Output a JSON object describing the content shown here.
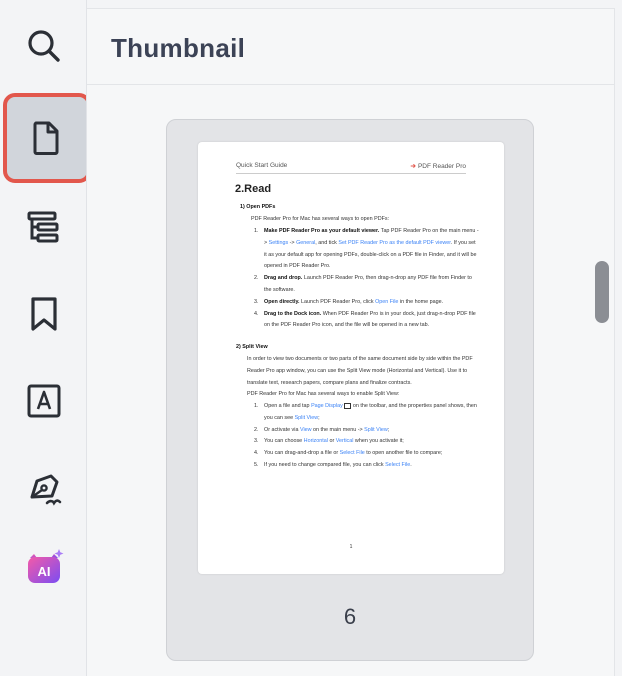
{
  "sidebar": {
    "items": [
      {
        "name": "search",
        "icon": "search-icon"
      },
      {
        "name": "thumbnail",
        "icon": "page-icon",
        "active": true
      },
      {
        "name": "outline",
        "icon": "outline-tree-icon"
      },
      {
        "name": "bookmarks",
        "icon": "bookmark-icon"
      },
      {
        "name": "annotation",
        "icon": "text-box-icon"
      },
      {
        "name": "signature",
        "icon": "pen-nib-icon"
      },
      {
        "name": "ai",
        "icon": "ai-assistant-icon",
        "label": "AI"
      }
    ]
  },
  "panel": {
    "title": "Thumbnail"
  },
  "thumbnail": {
    "page_label": "6",
    "page": {
      "header_left": "Quick Start Guide",
      "header_right": "PDF Reader Pro",
      "heading": "2.Read",
      "s1_title": "1)   Open PDFs",
      "s1_intro": "PDF Reader Pro for Mac has several ways to open PDFs:",
      "s1_i1_bold": "Make PDF Reader Pro as your default viewer.",
      "s1_i1_a": " Tap PDF Reader Pro on the main menu -> ",
      "s1_i1_link1": "Settings",
      "s1_i1_b": " -> ",
      "s1_i1_link2": "General",
      "s1_i1_c": ", and tick ",
      "s1_i1_link3": "Set PDF Reader Pro as the default PDF viewer",
      "s1_i1_d": ". If you set it as your default app for opening PDFs, double-click on a PDF file in Finder, and it will be opened in PDF Reader Pro.",
      "s1_i2_bold": "Drag and drop.",
      "s1_i2": " Launch PDF Reader Pro, then drag-n-drop any PDF file from Finder to the software.",
      "s1_i3_bold": "Open directly.",
      "s1_i3_a": " Launch PDF Reader Pro, click ",
      "s1_i3_link": "Open File",
      "s1_i3_b": " in the home page.",
      "s1_i4_bold": "Drag to the Dock icon.",
      "s1_i4": " When PDF Reader Pro is in your dock, just drag-n-drop PDF file on the PDF Reader Pro icon, and the file will be opened in a new tab.",
      "s2_title": "2) Split View",
      "s2_p1": "In order to view two documents or two parts of the same document side by side within the PDF Reader Pro app window, you can use the Split View mode (Horizontal and Vertical). Use it to translate text, research papers, compare plans and finalize contracts.",
      "s2_p2": "PDF Reader Pro for Mac has several ways to enable Split View:",
      "s2_i1_a": "Open a file and tap ",
      "s2_i1_link": "Page Display",
      "s2_i1_b": " on the toolbar, and the properties panel shows, then you can see ",
      "s2_i1_link2": "Split View",
      "s2_i1_c": ";",
      "s2_i2_a": "Or activate via ",
      "s2_i2_link": "View",
      "s2_i2_b": " on the main menu -> ",
      "s2_i2_link2": "Split View",
      "s2_i2_c": ";",
      "s2_i3_a": "You can choose ",
      "s2_i3_link": "Horizontal",
      "s2_i3_b": " or ",
      "s2_i3_link2": "Vertical",
      "s2_i3_c": " when you activate it;",
      "s2_i4_a": "You can drag-and-drop a file or ",
      "s2_i4_link": "Select File",
      "s2_i4_b": " to open another file to compare;",
      "s2_i5_a": "If you need to change compared file, you can click ",
      "s2_i5_link": "Select File",
      "s2_i5_b": ".",
      "footer": "1"
    }
  },
  "colors": {
    "active_border": "#e2574c",
    "link": "#3b82f6",
    "ai_gradient_start": "#f45aa8",
    "ai_gradient_end": "#7b4df2"
  }
}
